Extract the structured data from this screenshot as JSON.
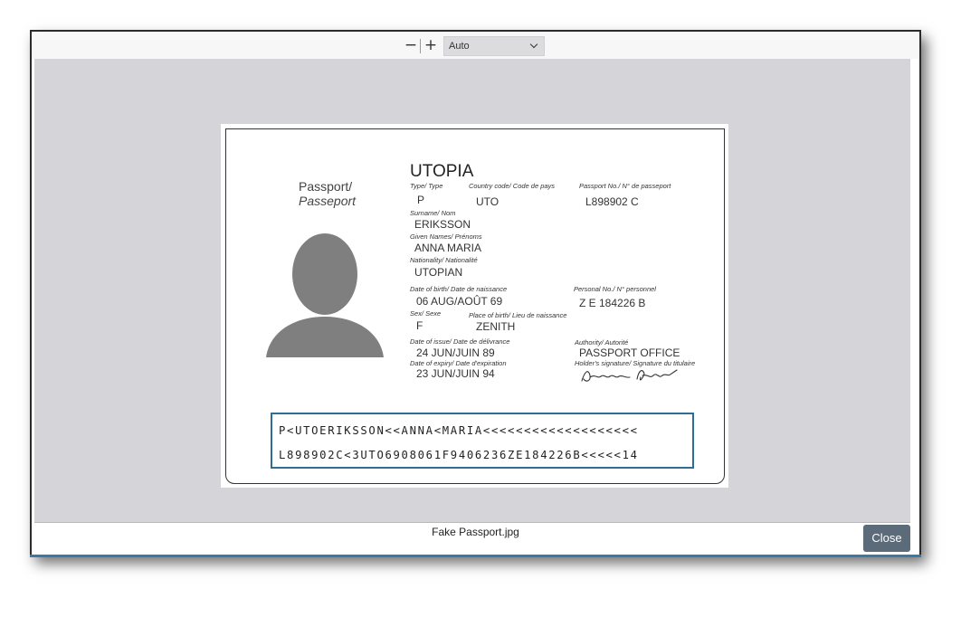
{
  "toolbar": {
    "zoom_out": "−",
    "zoom_in": "+",
    "zoom_level": "Auto"
  },
  "passport": {
    "doc_label_1": "Passport/",
    "doc_label_2": "Passeport",
    "country": "UTOPIA",
    "fields": {
      "type_label": "Type/ Type",
      "type": "P",
      "country_code_label": "Country code/ Code de pays",
      "country_code": "UTO",
      "passport_no_label": "Passport No./ N° de passeport",
      "passport_no": "L898902 C",
      "surname_label": "Surname/ Nom",
      "surname": "ERIKSSON",
      "given_names_label": "Given Names/ Prénoms",
      "given_names": "ANNA MARIA",
      "nationality_label": "Nationality/ Nationalité",
      "nationality": "UTOPIAN",
      "dob_label": "Date of birth/ Date de naissance",
      "dob": "06 AUG/AOÛT 69",
      "personal_no_label": "Personal No./ N° personnel",
      "personal_no": "Z E 184226 B",
      "sex_label": "Sex/ Sexe",
      "sex": "F",
      "pob_label": "Place of birth/ Lieu de naissance",
      "pob": "ZENITH",
      "issue_label": "Date of issue/ Date de délivrance",
      "issue": "24 JUN/JUIN 89",
      "authority_label": "Authority/ Autorité",
      "authority": "PASSPORT OFFICE",
      "expiry_label": "Date of expiry/ Date d'expiration",
      "expiry": "23 JUN/JUIN 94",
      "signature_label": "Holder's signature/ Signature du titulaire"
    },
    "mrz_line_1": "P<UTOERIKSSON<<ANNA<MARIA<<<<<<<<<<<<<<<<<<<",
    "mrz_line_2": "L898902C<3UTO6908061F9406236ZE184226B<<<<<14"
  },
  "file_name": "Fake Passport.jpg",
  "close_label": "Close"
}
